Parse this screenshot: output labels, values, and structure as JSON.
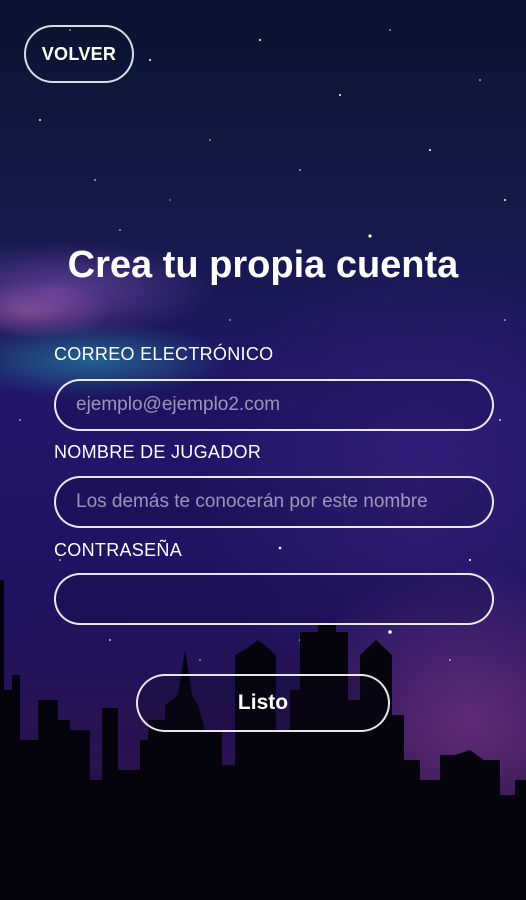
{
  "header": {
    "back_label": "VOLVER"
  },
  "form": {
    "title": "Crea tu propia cuenta",
    "email": {
      "label": "CORREO ELECTRÓNICO",
      "placeholder": "ejemplo@ejemplo2.com",
      "value": ""
    },
    "player_name": {
      "label": "NOMBRE DE JUGADOR",
      "placeholder": "Los demás te conocerán por este nombre",
      "value": ""
    },
    "password": {
      "label": "CONTRASEÑA",
      "placeholder": "",
      "value": ""
    },
    "submit_label": "Listo"
  },
  "theme": {
    "text": "#ffffff",
    "border": "#ffffff",
    "sky_top": "#0a1330",
    "sky_mid": "#22166b",
    "skyline": "#05030c"
  },
  "background": {
    "icon": "night-city-skyline"
  }
}
